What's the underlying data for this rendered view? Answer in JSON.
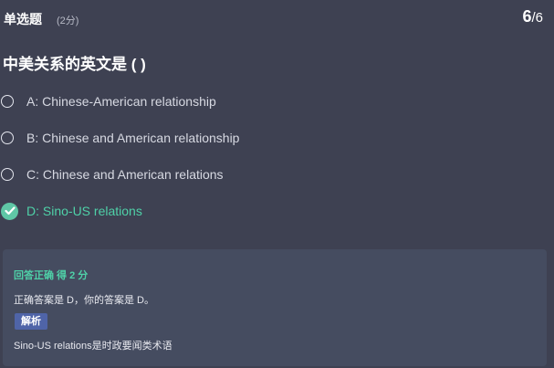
{
  "header": {
    "question_type": "单选题",
    "score": "(2分)",
    "progress_current": "6",
    "progress_separator": "/",
    "progress_total": "6"
  },
  "question": {
    "text": "中美关系的英文是 ( )"
  },
  "options": [
    {
      "label": "A: Chinese-American relationship",
      "selected": false
    },
    {
      "label": "B: Chinese and American relationship",
      "selected": false
    },
    {
      "label": "C: Chinese and American relations",
      "selected": false
    },
    {
      "label": "D: Sino-US relations",
      "selected": true
    }
  ],
  "result": {
    "title": "回答正确 得 2 分",
    "answer_line": "正确答案是 D，你的答案是 D。",
    "analysis_label": "解析",
    "analysis_text": "Sino-US relations是时政要闻类术语"
  },
  "colors": {
    "background": "#3e4152",
    "correct": "#4fd1a8",
    "panel": "#454c60",
    "badge": "#4f64a8"
  },
  "icons": {
    "unselected": "radio-unchecked-icon",
    "selected": "check-circle-icon"
  }
}
